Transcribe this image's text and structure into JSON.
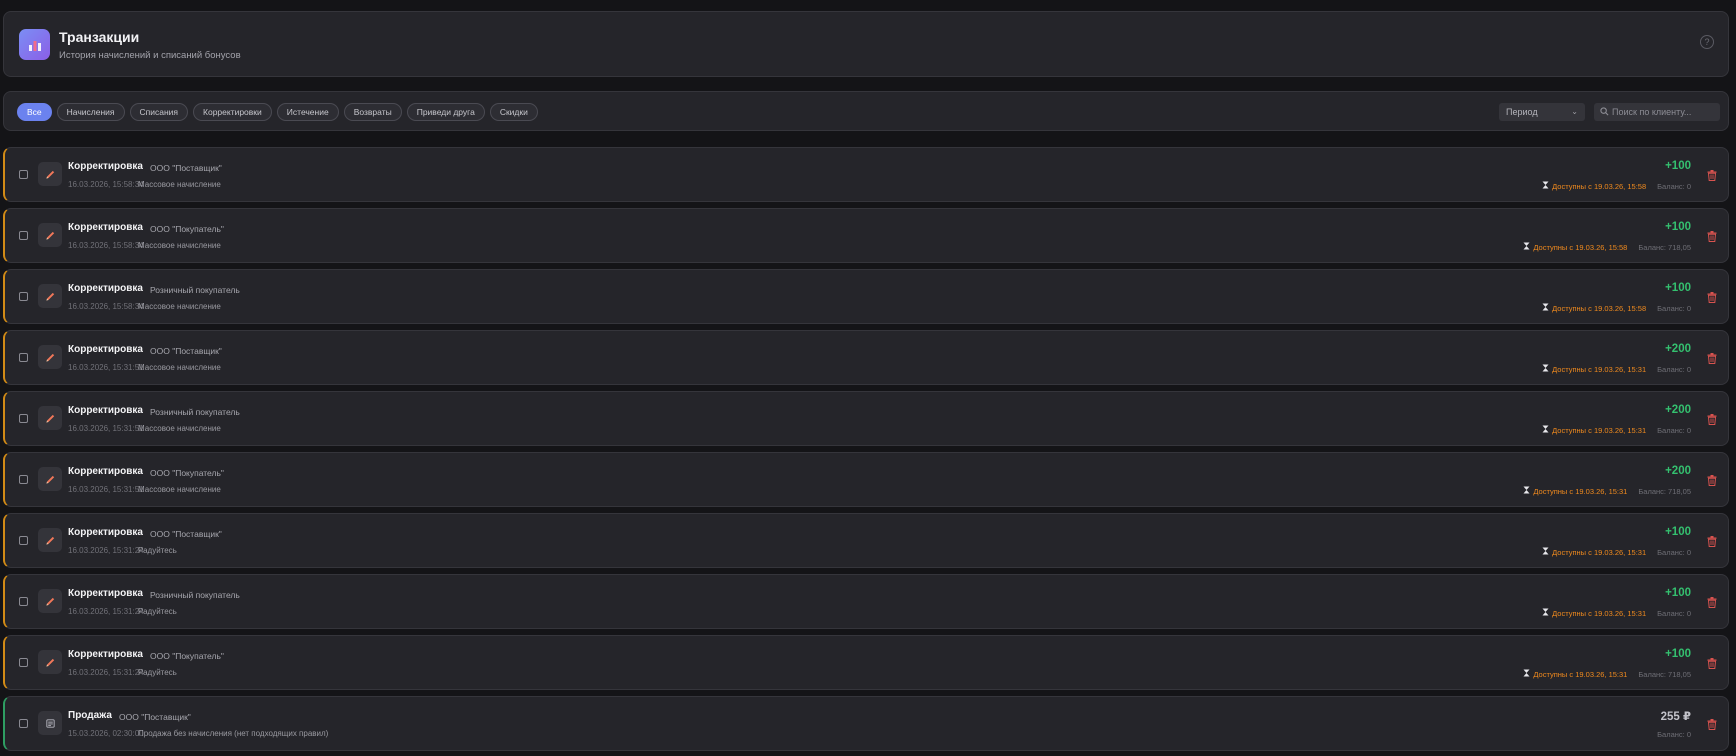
{
  "header": {
    "title": "Транзакции",
    "subtitle": "История начислений и списаний бонусов",
    "help_icon": "help-circle-icon",
    "app_icon": "bar-chart-icon"
  },
  "filters": {
    "chips": [
      {
        "label": "Все",
        "active": true
      },
      {
        "label": "Начисления",
        "active": false
      },
      {
        "label": "Списания",
        "active": false
      },
      {
        "label": "Корректировки",
        "active": false
      },
      {
        "label": "Истечение",
        "active": false
      },
      {
        "label": "Возвраты",
        "active": false
      },
      {
        "label": "Приведи друга",
        "active": false
      },
      {
        "label": "Скидки",
        "active": false
      }
    ],
    "period": {
      "value": "Период"
    },
    "search": {
      "placeholder": "Поиск по клиенту..."
    }
  },
  "colors": {
    "accent": "#6b82ef",
    "positive": "#34c06f",
    "warning": "#f08a1e",
    "adjustment_border": "#d28b16",
    "sale_border": "#2e9e62",
    "delete": "#d9534f"
  },
  "transactions": [
    {
      "type": "Корректировка",
      "client": "ООО \"Поставщик\"",
      "date": "16.03.2026, 15:58:34",
      "note": "Массовое начисление",
      "amount": "+100",
      "available": "Доступны с 19.03.26, 15:58",
      "balance": "Баланс: 0",
      "icon": "pencil-icon"
    },
    {
      "type": "Корректировка",
      "client": "ООО \"Покупатель\"",
      "date": "16.03.2026, 15:58:34",
      "note": "Массовое начисление",
      "amount": "+100",
      "available": "Доступны с 19.03.26, 15:58",
      "balance": "Баланс: 718,05",
      "icon": "pencil-icon"
    },
    {
      "type": "Корректировка",
      "client": "Розничный покупатель",
      "date": "16.03.2026, 15:58:34",
      "note": "Массовое начисление",
      "amount": "+100",
      "available": "Доступны с 19.03.26, 15:58",
      "balance": "Баланс: 0",
      "icon": "pencil-icon"
    },
    {
      "type": "Корректировка",
      "client": "ООО \"Поставщик\"",
      "date": "16.03.2026, 15:31:51",
      "note": "Массовое начисление",
      "amount": "+200",
      "available": "Доступны с 19.03.26, 15:31",
      "balance": "Баланс: 0",
      "icon": "pencil-icon"
    },
    {
      "type": "Корректировка",
      "client": "Розничный покупатель",
      "date": "16.03.2026, 15:31:51",
      "note": "Массовое начисление",
      "amount": "+200",
      "available": "Доступны с 19.03.26, 15:31",
      "balance": "Баланс: 0",
      "icon": "pencil-icon"
    },
    {
      "type": "Корректировка",
      "client": "ООО \"Покупатель\"",
      "date": "16.03.2026, 15:31:51",
      "note": "Массовое начисление",
      "amount": "+200",
      "available": "Доступны с 19.03.26, 15:31",
      "balance": "Баланс: 718,05",
      "icon": "pencil-icon"
    },
    {
      "type": "Корректировка",
      "client": "ООО \"Поставщик\"",
      "date": "16.03.2026, 15:31:24",
      "note": "Радуйтесь",
      "amount": "+100",
      "available": "Доступны с 19.03.26, 15:31",
      "balance": "Баланс: 0",
      "icon": "pencil-icon"
    },
    {
      "type": "Корректировка",
      "client": "Розничный покупатель",
      "date": "16.03.2026, 15:31:24",
      "note": "Радуйтесь",
      "amount": "+100",
      "available": "Доступны с 19.03.26, 15:31",
      "balance": "Баланс: 0",
      "icon": "pencil-icon"
    },
    {
      "type": "Корректировка",
      "client": "ООО \"Покупатель\"",
      "date": "16.03.2026, 15:31:24",
      "note": "Радуйтесь",
      "amount": "+100",
      "available": "Доступны с 19.03.26, 15:31",
      "balance": "Баланс: 718,05",
      "icon": "pencil-icon"
    },
    {
      "type": "Продажа",
      "client": "ООО \"Поставщик\"",
      "date": "15.03.2026, 02:30:00",
      "note": "Продажа без начисления (нет подходящих правил)",
      "amount": "255 ₽",
      "available": "",
      "balance": "Баланс: 0",
      "icon": "receipt-icon"
    }
  ]
}
